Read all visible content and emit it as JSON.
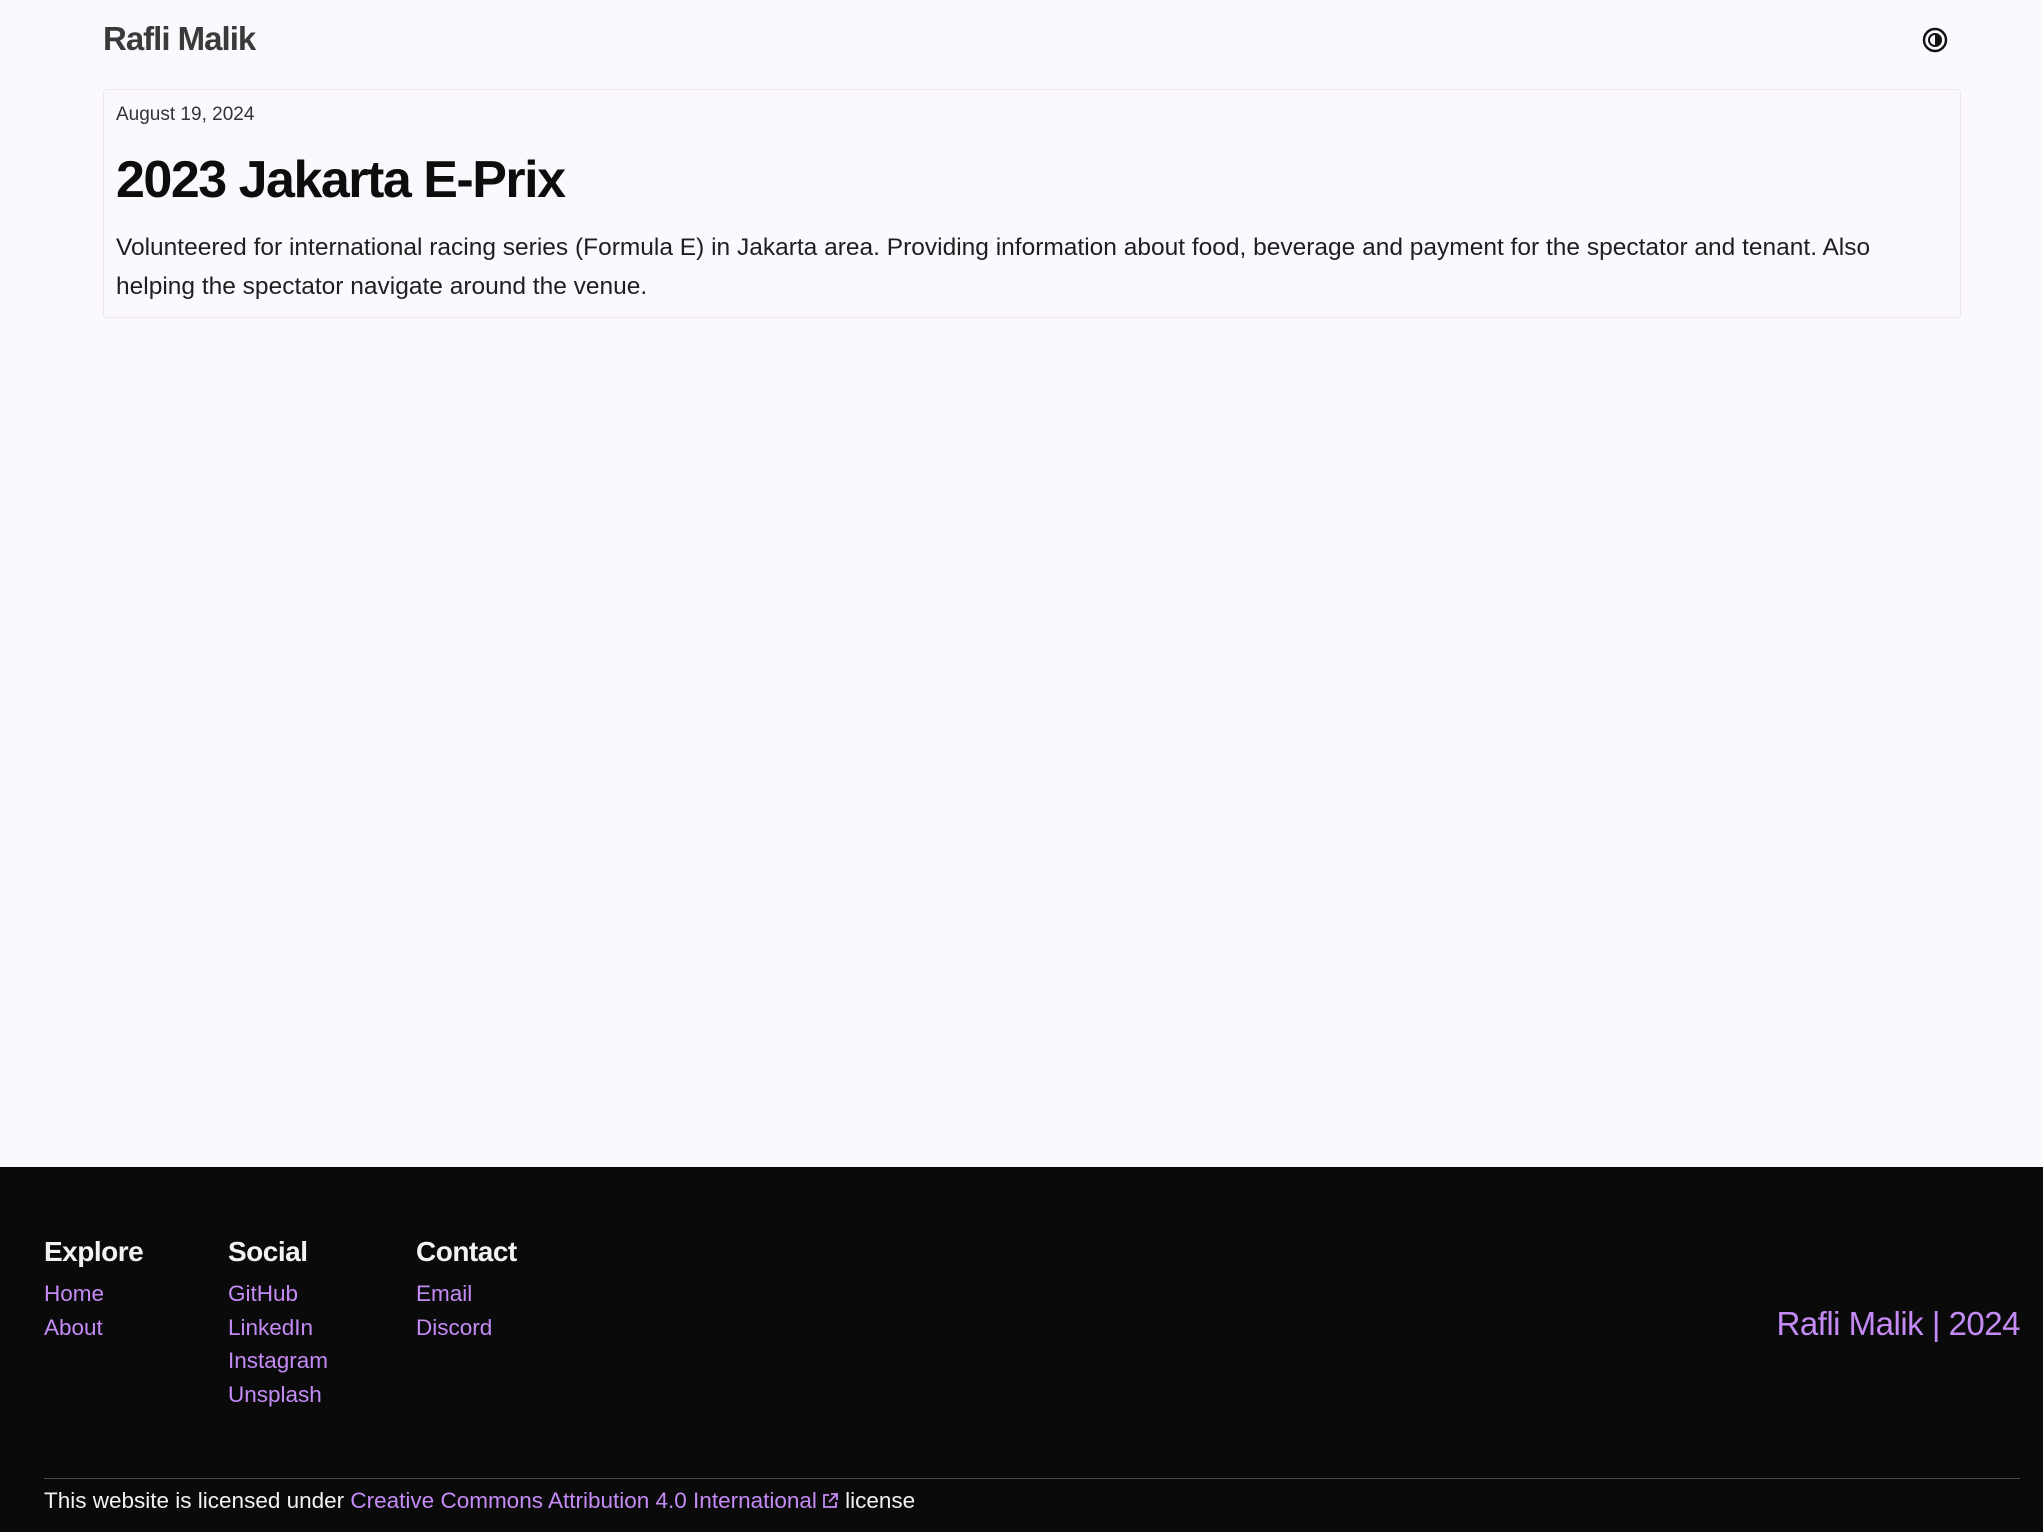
{
  "header": {
    "site_title": "Rafli Malik",
    "theme_toggle_icon": "contrast-icon"
  },
  "post": {
    "date": "August 19, 2024",
    "title": "2023 Jakarta E-Prix",
    "body": "Volunteered for international racing series (Formula E) in Jakarta area. Providing information about food, beverage and payment for the spectator and tenant. Also helping the spectator navigate around the venue."
  },
  "footer": {
    "explore": {
      "heading": "Explore",
      "links": [
        "Home",
        "About"
      ]
    },
    "social": {
      "heading": "Social",
      "links": [
        "GitHub",
        "LinkedIn",
        "Instagram",
        "Unsplash"
      ]
    },
    "contact": {
      "heading": "Contact",
      "links": [
        "Email",
        "Discord"
      ]
    },
    "brand": "Rafli Malik | 2024",
    "license": {
      "prefix": "This website is licensed under ",
      "link": "Creative Commons Attribution 4.0 International",
      "suffix": " license",
      "link_icon": "external-link-icon"
    }
  },
  "colors": {
    "background": "#fbf8fe",
    "footer_background": "#0a0a0b",
    "accent": "#c58bf5"
  }
}
